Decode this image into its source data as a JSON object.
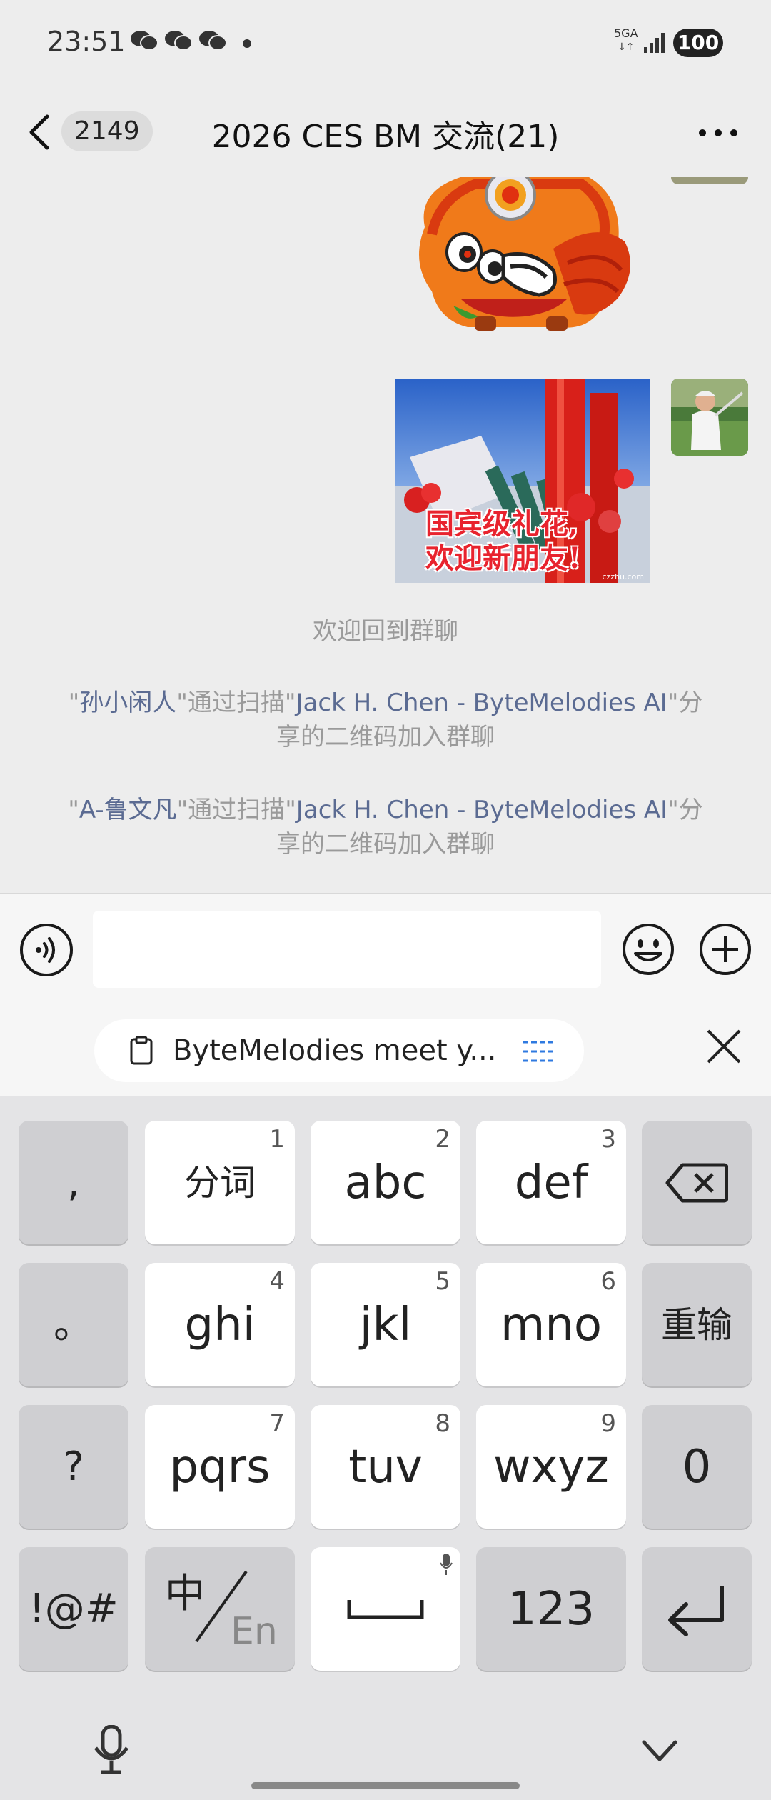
{
  "status_bar": {
    "time": "23:51",
    "network": "5GA",
    "battery": "100",
    "notification_icons": [
      "wechat-icon",
      "wechat-icon",
      "wechat-icon"
    ]
  },
  "header": {
    "unread_count": "2149",
    "title": "2026 CES BM 交流(21)"
  },
  "chat": {
    "image_caption": "国宾级礼花,\n欢迎新朋友!",
    "image_watermark": "czzhu.com",
    "system_messages": [
      {
        "text": "欢迎回到群聊"
      },
      {
        "q1": "\"",
        "name": "孙小闲人",
        "q2": "\"通过扫描\"",
        "sharer": "Jack H. Chen - ByteMelodies AI",
        "q3": "\"分享的二维码加入群聊"
      },
      {
        "q1": "\"",
        "name": "A-鲁文凡",
        "q2": "\"通过扫描\"",
        "sharer": "Jack H. Chen - ByteMelodies AI",
        "q3": "\"分享的二维码加入群聊"
      }
    ]
  },
  "input": {
    "value": "",
    "placeholder": ""
  },
  "clipboard": {
    "text": "ByteMelodies meet y..."
  },
  "keyboard": {
    "row1": [
      {
        "label": ","
      },
      {
        "label": "分词",
        "num": "1"
      },
      {
        "label": "abc",
        "num": "2"
      },
      {
        "label": "def",
        "num": "3"
      }
    ],
    "row2": [
      {
        "label": "。"
      },
      {
        "label": "ghi",
        "num": "4"
      },
      {
        "label": "jkl",
        "num": "5"
      },
      {
        "label": "mno",
        "num": "6"
      },
      {
        "label": "重输"
      }
    ],
    "row3": [
      {
        "label": "?"
      },
      {
        "label": "pqrs",
        "num": "7"
      },
      {
        "label": "tuv",
        "num": "8"
      },
      {
        "label": "wxyz",
        "num": "9"
      },
      {
        "label": "0"
      }
    ],
    "row4": [
      {
        "label": "!@#"
      },
      {
        "label_cn": "中",
        "label_en": "En"
      },
      {
        "label": ""
      },
      {
        "label": "123"
      }
    ]
  },
  "colors": {
    "background": "#ededed",
    "link": "#5b6b92",
    "system_text": "#9a9a9a",
    "keyboard_bg": "#e4e4e6"
  }
}
